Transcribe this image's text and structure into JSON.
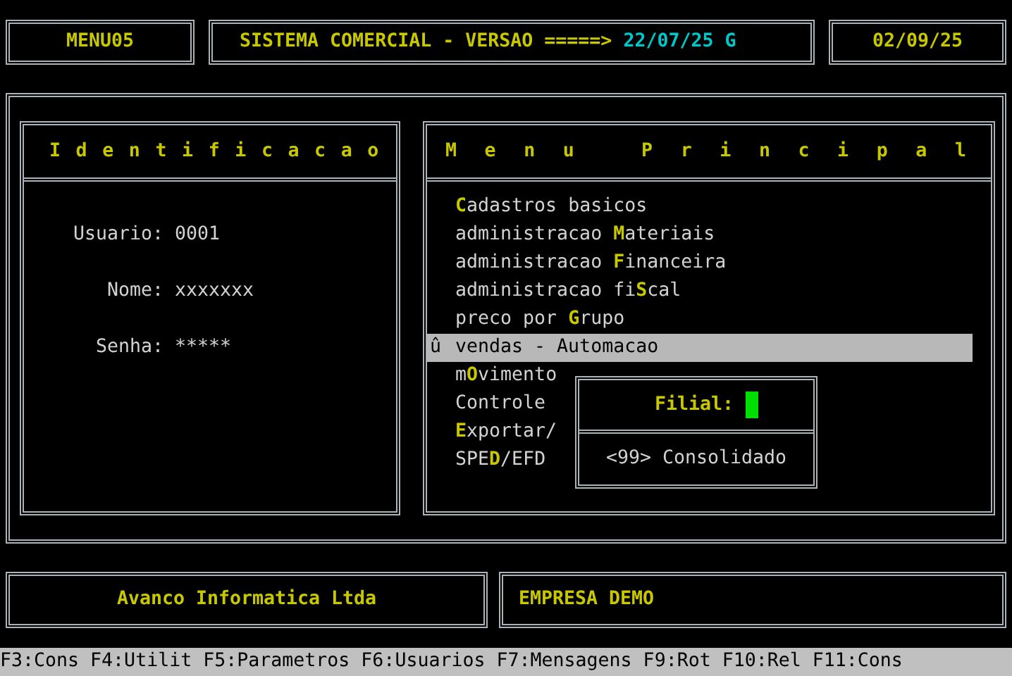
{
  "header": {
    "screen_id": "MENU05",
    "title": "SISTEMA COMERCIAL - VERSAO =====>",
    "version": "22/07/25 G",
    "date": "02/09/25"
  },
  "identification": {
    "title": "Identificacao",
    "fields": [
      {
        "label": "Usuario:",
        "value": "0001"
      },
      {
        "label": "Nome:",
        "value": "xxxxxxx"
      },
      {
        "label": "Senha:",
        "value": "*****"
      }
    ]
  },
  "menu": {
    "title": "Menu Principal",
    "items": [
      {
        "key": "C",
        "after": "adastros basicos",
        "selected": false
      },
      {
        "before": "administracao ",
        "key": "M",
        "after": "ateriais",
        "selected": false
      },
      {
        "before": "administracao ",
        "key": "F",
        "after": "inanceira",
        "selected": false
      },
      {
        "before": "administracao fi",
        "key": "S",
        "after": "cal",
        "selected": false
      },
      {
        "before": "preco por ",
        "key": "G",
        "after": "rupo",
        "selected": false
      },
      {
        "marker": "û",
        "before": "vendas - Automacao",
        "selected": true
      },
      {
        "before": "m",
        "key": "O",
        "after": "vimento",
        "selected": false
      },
      {
        "before": "Controle",
        "selected": false
      },
      {
        "key": "E",
        "after": "xportar/",
        "selected": false
      },
      {
        "before": "SPE",
        "key": "D",
        "after": "/EFD",
        "selected": false
      }
    ]
  },
  "branch_dialog": {
    "label": "Filial:",
    "option": "<99> Consolidado"
  },
  "footer": {
    "company": "Avanco Informatica Ltda",
    "tenant": "EMPRESA DEMO"
  },
  "status_bar": "F3:Cons F4:Utilit F5:Parametros F6:Usuarios F7:Mensagens F9:Rot F10:Rel F11:Cons"
}
